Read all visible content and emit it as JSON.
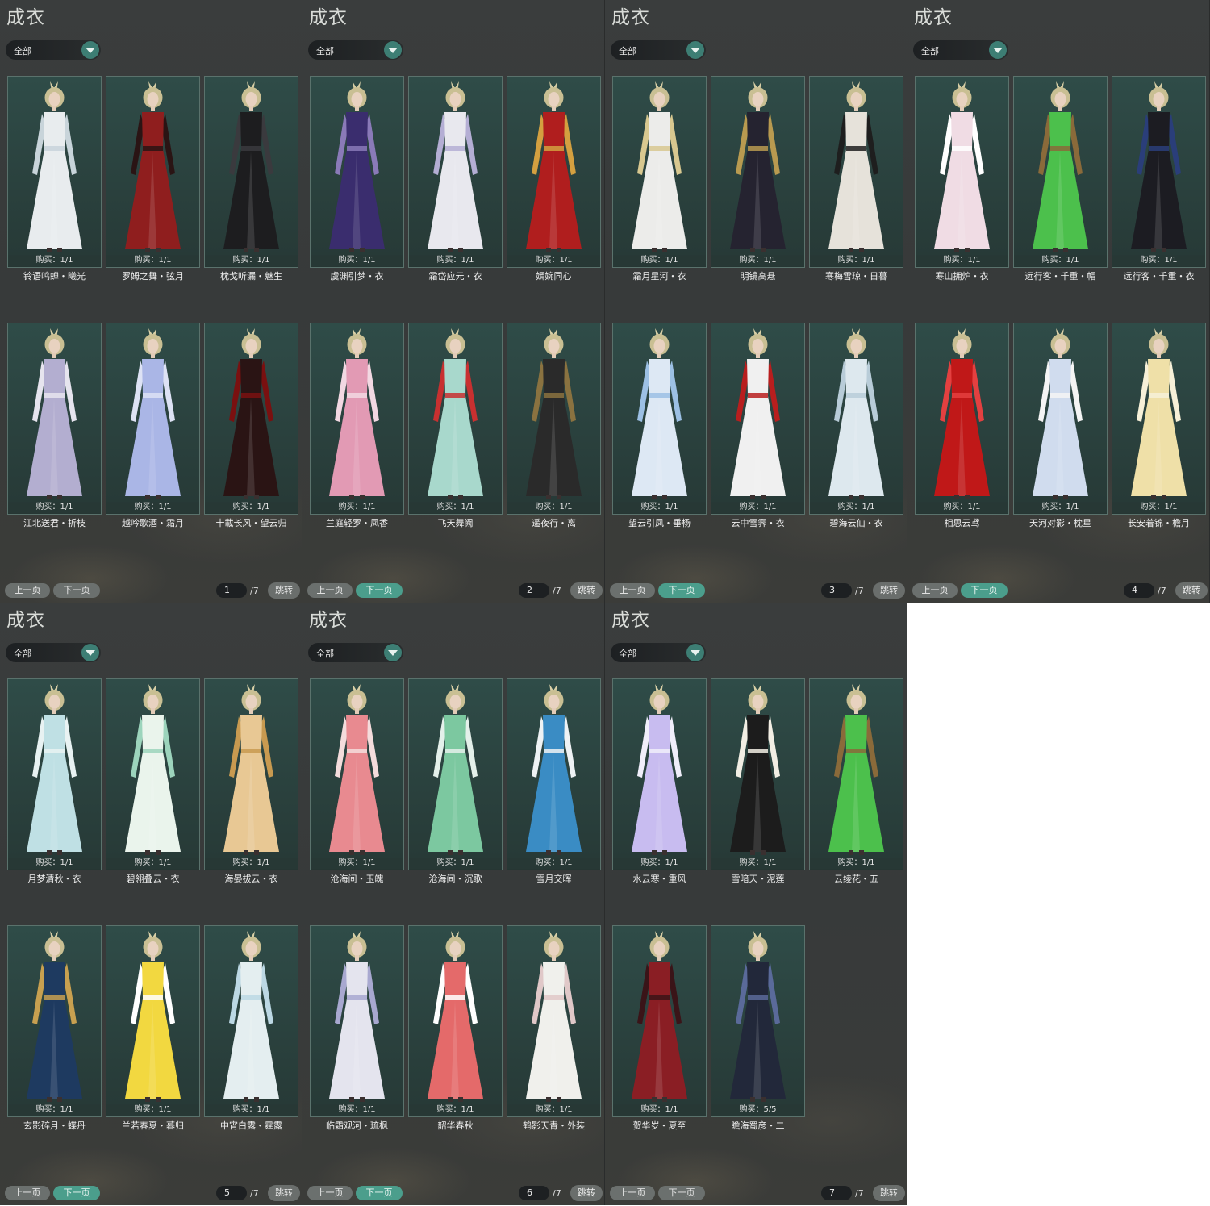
{
  "title": "成衣",
  "filter": "全部",
  "buttons": {
    "prev": "上一页",
    "next": "下一页",
    "jump": "跳转"
  },
  "total_pages": "/7",
  "pages": [
    {
      "page": "1",
      "next_active": false,
      "items": [
        {
          "name": "铃语鸣蝉・曦光",
          "buy": "购买：1/1",
          "dress": "#e8ecee",
          "accent": "#c8d4da"
        },
        {
          "name": "罗姆之舞・弦月",
          "buy": "购买：1/1",
          "dress": "#8f1e1e",
          "accent": "#2a1414"
        },
        {
          "name": "枕戈听漏・魅生",
          "buy": "购买：1/1",
          "dress": "#1d1d1f",
          "accent": "#3a3a3e"
        },
        {
          "name": "江北送君・折枝",
          "buy": "购买：1/1",
          "dress": "#b3aed0",
          "accent": "#e6e4ee"
        },
        {
          "name": "越吟歌酒・霜月",
          "buy": "购买：1/1",
          "dress": "#aab6e6",
          "accent": "#dde2f4"
        },
        {
          "name": "十載长风・望云归",
          "buy": "购买：1/1",
          "dress": "#2a1414",
          "accent": "#7a1010"
        }
      ]
    },
    {
      "page": "2",
      "next_active": true,
      "items": [
        {
          "name": "虞渊引梦・衣",
          "buy": "购买：1/1",
          "dress": "#3a2d6e",
          "accent": "#8a7ab8"
        },
        {
          "name": "霜岱应元・衣",
          "buy": "购买：1/1",
          "dress": "#e8e8ee",
          "accent": "#b4aed4"
        },
        {
          "name": "嫣婉同心",
          "buy": "购买：1/1",
          "dress": "#b01e1e",
          "accent": "#d4a040"
        },
        {
          "name": "兰庭轻罗・凤香",
          "buy": "购买：1/1",
          "dress": "#e29ab4",
          "accent": "#f2d8e2"
        },
        {
          "name": "飞天舞阙",
          "buy": "购买：1/1",
          "dress": "#a8d8cc",
          "accent": "#c83030"
        },
        {
          "name": "遥夜行・离",
          "buy": "购买：1/1",
          "dress": "#2a2a2a",
          "accent": "#8a7240"
        }
      ]
    },
    {
      "page": "3",
      "next_active": true,
      "items": [
        {
          "name": "霜月星河・衣",
          "buy": "购买：1/1",
          "dress": "#ececea",
          "accent": "#d8c890"
        },
        {
          "name": "明镜高悬",
          "buy": "购买：1/1",
          "dress": "#252330",
          "accent": "#b89a50"
        },
        {
          "name": "寒梅雪琼・日暮",
          "buy": "购买：1/1",
          "dress": "#e6e2da",
          "accent": "#1e1e1e"
        },
        {
          "name": "望云引凤・垂杨",
          "buy": "购买：1/1",
          "dress": "#dde8f4",
          "accent": "#9cc0e4"
        },
        {
          "name": "云中雪霁・衣",
          "buy": "购买：1/1",
          "dress": "#f0f0f0",
          "accent": "#b81e1e"
        },
        {
          "name": "碧海云仙・衣",
          "buy": "购买：1/1",
          "dress": "#dde8ee",
          "accent": "#b8ccd8"
        }
      ]
    },
    {
      "page": "4",
      "next_active": true,
      "items": [
        {
          "name": "寒山拥炉・衣",
          "buy": "购买：1/1",
          "dress": "#f0dce4",
          "accent": "#ffffff"
        },
        {
          "name": "远行客・千重・帽",
          "buy": "购买：1/1",
          "dress": "#4cc04c",
          "accent": "#8a6a3a"
        },
        {
          "name": "远行客・千重・衣",
          "buy": "购买：1/1",
          "dress": "#1c1c22",
          "accent": "#2a3e7a"
        },
        {
          "name": "相思云鸢",
          "buy": "购买：1/1",
          "dress": "#c01818",
          "accent": "#e44040"
        },
        {
          "name": "天河对影・枕星",
          "buy": "购买：1/1",
          "dress": "#d0dcee",
          "accent": "#f4f4f4"
        },
        {
          "name": "长安着锦・檐月",
          "buy": "购买：1/1",
          "dress": "#efe0a8",
          "accent": "#f6f0d8"
        }
      ]
    },
    {
      "page": "5",
      "next_active": true,
      "items": [
        {
          "name": "月梦清秋・衣",
          "buy": "购买：1/1",
          "dress": "#bfe0e4",
          "accent": "#e8f2f2"
        },
        {
          "name": "碧翎叠云・衣",
          "buy": "购买：1/1",
          "dress": "#eaf4ec",
          "accent": "#9cd4bc"
        },
        {
          "name": "海晏拔云・衣",
          "buy": "购买：1/1",
          "dress": "#e8c894",
          "accent": "#c89a50"
        },
        {
          "name": "玄影碎月・蝶丹",
          "buy": "购买：1/1",
          "dress": "#1e3a60",
          "accent": "#c8a050"
        },
        {
          "name": "兰若春夏・暮归",
          "buy": "购买：1/1",
          "dress": "#f2d840",
          "accent": "#ffffff"
        },
        {
          "name": "中宵白露・霆露",
          "buy": "购买：1/1",
          "dress": "#e4eef0",
          "accent": "#bcd8e4"
        }
      ]
    },
    {
      "page": "6",
      "next_active": true,
      "items": [
        {
          "name": "沧海间・玉魄",
          "buy": "购买：1/1",
          "dress": "#e88a90",
          "accent": "#f4dcdc"
        },
        {
          "name": "沧海间・沉歌",
          "buy": "购买：1/1",
          "dress": "#7cc8a0",
          "accent": "#e4f0ea"
        },
        {
          "name": "雪月交晖",
          "buy": "购买：1/1",
          "dress": "#3a8cc4",
          "accent": "#eef2f4"
        },
        {
          "name": "临霜观河・琉枫",
          "buy": "购买：1/1",
          "dress": "#e4e4ee",
          "accent": "#a8a8d0"
        },
        {
          "name": "韶华春秋",
          "buy": "购买：1/1",
          "dress": "#e46a6a",
          "accent": "#ffffff"
        },
        {
          "name": "鹤影天青・外装",
          "buy": "购买：1/1",
          "dress": "#f0f0ec",
          "accent": "#e0c8c8"
        }
      ]
    },
    {
      "page": "7",
      "next_active": false,
      "items": [
        {
          "name": "水云寒・重风",
          "buy": "购买：1/1",
          "dress": "#c8bcf0",
          "accent": "#f0eefa"
        },
        {
          "name": "雪暗天・泥莲",
          "buy": "购买：1/1",
          "dress": "#1c1c1c",
          "accent": "#f2eee4"
        },
        {
          "name": "云绫花・五",
          "buy": "购买：1/1",
          "dress": "#4cc04c",
          "accent": "#8a6a3a"
        },
        {
          "name": "贺华岁・夏至",
          "buy": "购买：1/1",
          "dress": "#8a1e24",
          "accent": "#3a1418"
        },
        {
          "name": "瞻海蜀彦・二",
          "buy": "购买：5/5",
          "dress": "#22283a",
          "accent": "#5a6a9a"
        }
      ]
    }
  ]
}
